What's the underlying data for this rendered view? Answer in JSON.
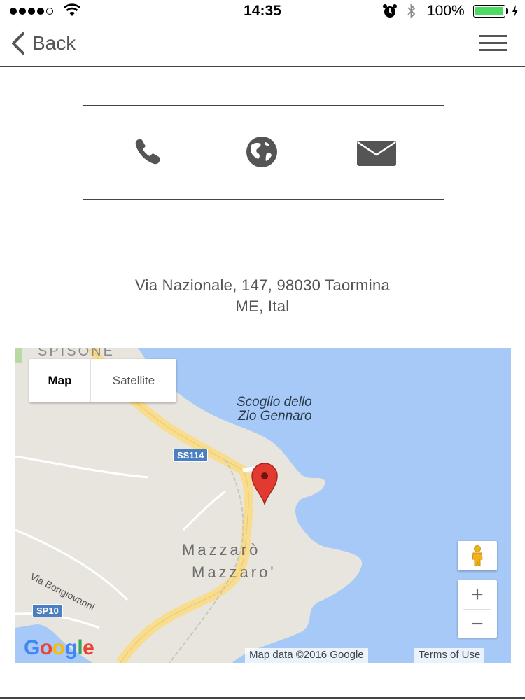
{
  "status_bar": {
    "time": "14:35",
    "battery_percent": "100%",
    "battery_level": 1.0,
    "signal_bars": 4
  },
  "nav": {
    "back_label": "Back"
  },
  "contact": {
    "phone_icon": "phone-icon",
    "website_icon": "globe-icon",
    "email_icon": "envelope-icon"
  },
  "address": {
    "line1": "Via Nazionale, 147, 98030 Taormina",
    "line2": "ME, Ital"
  },
  "map": {
    "type_map_label": "Map",
    "type_satellite_label": "Satellite",
    "places": {
      "spisone": "SPISONE",
      "scoglio_line1": "Scoglio dello",
      "scoglio_line2": "Zio Gennaro",
      "mazzaro1": "Mazzarò",
      "mazzaro2": "Mazzaro'",
      "via_bongiovanni": "Via Bongiovanni"
    },
    "road_badges": {
      "ss114": "SS114",
      "sp10": "SP10"
    },
    "zoom_in": "+",
    "zoom_out": "−",
    "attribution": "Map data ©2016 Google",
    "terms": "Terms of Use",
    "logo": "Google",
    "colors": {
      "water": "#a6c9f7",
      "land": "#e8e5df",
      "road": "#f9dd8f",
      "pin": "#e33a30"
    }
  }
}
